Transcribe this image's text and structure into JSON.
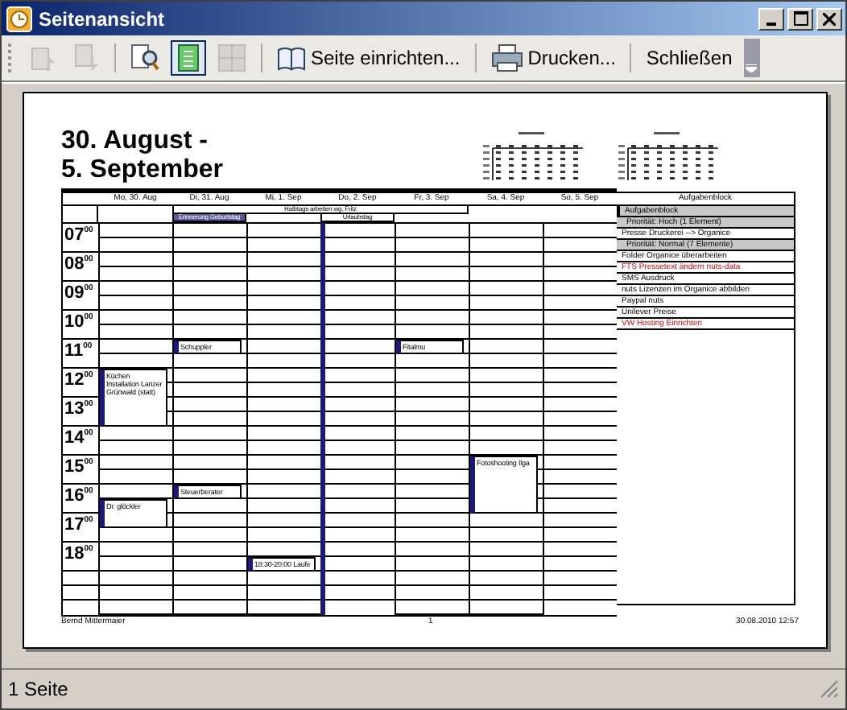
{
  "window": {
    "title": "Seitenansicht"
  },
  "toolbar": [
    {
      "kind": "icon",
      "disabled": true,
      "selected": false
    },
    {
      "kind": "icon",
      "disabled": true,
      "selected": false
    },
    {
      "kind": "separator"
    },
    {
      "kind": "icon",
      "disabled": false,
      "selected": false
    },
    {
      "kind": "icon",
      "disabled": false,
      "selected": true
    },
    {
      "kind": "icon",
      "disabled": true,
      "selected": false
    },
    {
      "kind": "separator"
    },
    {
      "kind": "text",
      "label": "Seite einrichten...",
      "disabled": false,
      "selected": false
    },
    {
      "kind": "separator"
    },
    {
      "kind": "text",
      "label": "Drucken...",
      "disabled": false,
      "selected": false
    },
    {
      "kind": "separator"
    },
    {
      "kind": "text",
      "label": "Schließen",
      "disabled": false,
      "selected": false
    }
  ],
  "page": {
    "title_lines": [
      "30. August -",
      "5. September"
    ],
    "days": [
      {
        "label": "Mo, 30. Aug",
        "out_of_office": false,
        "events": [
          {
            "text": "Küchen Installation Lanzer Grünwald (statt)"
          },
          {
            "text": "Dr. glöckler"
          }
        ]
      },
      {
        "label": "Di, 31. Aug",
        "out_of_office": false,
        "events": [
          {
            "text": "Schuppler"
          },
          {
            "text": "Steuerberater"
          }
        ]
      },
      {
        "label": "Mi, 1. Sep",
        "out_of_office": false,
        "events": [
          {
            "text": "18:30-20:00 Laufe"
          }
        ]
      },
      {
        "label": "Do, 2. Sep",
        "out_of_office": true
      },
      {
        "label": "Fr, 3. Sep",
        "out_of_office": false,
        "events": [
          {
            "text": "Fitalmu"
          }
        ]
      },
      {
        "label": "Sa, 4. Sep",
        "out_of_office": false,
        "events": [
          {
            "text": "Fotoshooting Ilga"
          }
        ]
      },
      {
        "label": "So, 5. Sep",
        "out_of_office": false
      }
    ],
    "all_day": [
      {
        "text": "Halbtags arbeiten wg. Fritz",
        "highlighted": false
      },
      {
        "text": "Erinnerung Geburtstag",
        "highlighted": true
      },
      {
        "text": "Urlaubstag",
        "highlighted": false
      }
    ],
    "hours": [
      "07$^{00}$",
      "08$^{00}$",
      "09$^{00}$",
      "10$^{00}$",
      "11$^{00}$",
      "12$^{00}$",
      "13$^{00}$",
      "14$^{00}$",
      "15$^{00}$",
      "16$^{00}$",
      "17$^{00}$",
      "18$^{00}$"
    ],
    "tasks_title": "Aufgabenblock",
    "tasks": [
      {
        "kind": "group",
        "text": "Aufgabenblock",
        "overdue": false
      },
      {
        "kind": "subgroup",
        "text": "Priorität: Hoch (1 Element)",
        "overdue": false
      },
      {
        "kind": "task",
        "text": "Presse Druckerei --> Organice",
        "overdue": false
      },
      {
        "kind": "subgroup",
        "text": "Priorität: Normal (7 Elemente)",
        "overdue": false
      },
      {
        "kind": "task",
        "text": "Folder Organice überarbeiten",
        "overdue": false
      },
      {
        "kind": "task",
        "text": "FTS Pressetext ändern nuts-data",
        "overdue": true
      },
      {
        "kind": "task",
        "text": "SMS Ausdruck",
        "overdue": false
      },
      {
        "kind": "task",
        "text": "nuts Lizenzen im Organice abbilden",
        "overdue": false
      },
      {
        "kind": "task",
        "text": "Paypal nuts",
        "overdue": false
      },
      {
        "kind": "task",
        "text": "Unilever Preise",
        "overdue": false
      },
      {
        "kind": "task",
        "text": "VW Hosting Einrichten",
        "overdue": true
      }
    ],
    "footer": {
      "left": "Bernd Mittermaier",
      "center": "1",
      "right": "30.08.2010 12:57"
    }
  },
  "status_bar": {
    "text": "1 Seite"
  }
}
